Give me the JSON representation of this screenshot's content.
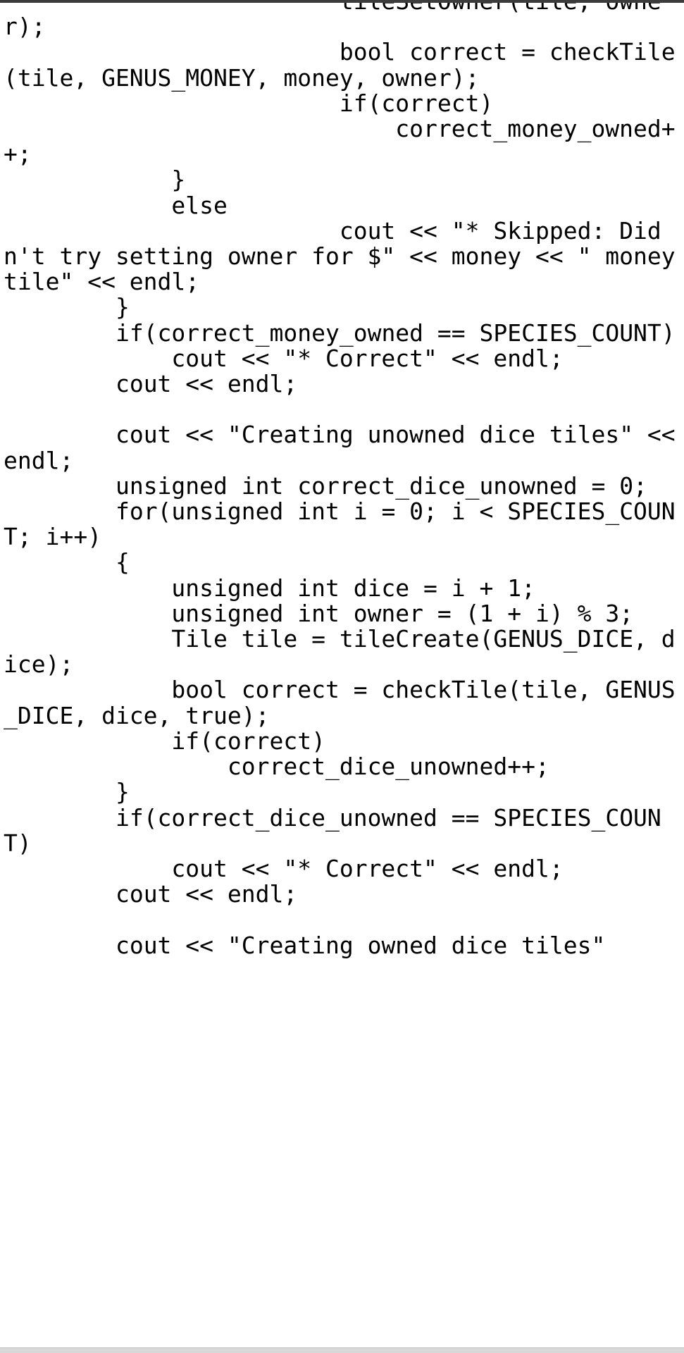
{
  "window": {
    "type": "code-text-viewer",
    "background_color": "#ffffff",
    "text_color": "#000000",
    "top_bar_color": "#3c3c3c",
    "bottom_bar_color": "#d8d8d8"
  },
  "code": {
    "language": "cpp",
    "wrap_columns": 42,
    "lines": [
      "                        tileSetOwner(tile, owner);",
      "                        bool correct = checkTile(tile, GENUS_MONEY, money, owner);",
      "                        if(correct)",
      "                            correct_money_owned++;",
      "            }",
      "            else",
      "                        cout << \"* Skipped: Didn't try setting owner for $\" << money << \" money tile\" << endl;",
      "        }",
      "        if(correct_money_owned == SPECIES_COUNT)",
      "            cout << \"* Correct\" << endl;",
      "        cout << endl;",
      "",
      "        cout << \"Creating unowned dice tiles\" << endl;",
      "        unsigned int correct_dice_unowned = 0;",
      "        for(unsigned int i = 0; i < SPECIES_COUNT; i++)",
      "        {",
      "            unsigned int dice = i + 1;",
      "            unsigned int owner = (1 + i) % 3;",
      "            Tile tile = tileCreate(GENUS_DICE, dice);",
      "            bool correct = checkTile(tile, GENUS_DICE, dice, true);",
      "            if(correct)",
      "                correct_dice_unowned++;",
      "        }",
      "        if(correct_dice_unowned == SPECIES_COUNT)",
      "            cout << \"* Correct\" << endl;",
      "        cout << endl;",
      "",
      "        cout << \"Creating owned dice tiles\""
    ],
    "full_text": "                        tileSetOwner(tile, owner);\n                        bool correct = checkTile(tile, GENUS_MONEY, money, owner);\n                        if(correct)\n                            correct_money_owned++;\n            }\n            else\n                        cout << \"* Skipped: Didn't try setting owner for $\" << money << \" money tile\" << endl;\n        }\n        if(correct_money_owned == SPECIES_COUNT)\n            cout << \"* Correct\" << endl;\n        cout << endl;\n\n        cout << \"Creating unowned dice tiles\" << endl;\n        unsigned int correct_dice_unowned = 0;\n        for(unsigned int i = 0; i < SPECIES_COUNT; i++)\n        {\n            unsigned int dice = i + 1;\n            unsigned int owner = (1 + i) % 3;\n            Tile tile = tileCreate(GENUS_DICE, dice);\n            bool correct = checkTile(tile, GENUS_DICE, dice, true);\n            if(correct)\n                correct_dice_unowned++;\n        }\n        if(correct_dice_unowned == SPECIES_COUNT)\n            cout << \"* Correct\" << endl;\n        cout << endl;\n\n        cout << \"Creating owned dice tiles\"",
    "identifiers": [
      "tileSetOwner",
      "tile",
      "owner",
      "bool",
      "correct",
      "checkTile",
      "GENUS_MONEY",
      "money",
      "if",
      "correct_money_owned",
      "else",
      "cout",
      "endl",
      "SPECIES_COUNT",
      "unsigned",
      "int",
      "correct_dice_unowned",
      "for",
      "dice",
      "Tile",
      "tileCreate",
      "GENUS_DICE",
      "true"
    ],
    "strings": [
      "* Skipped: Didn't try setting owner for $",
      " money tile",
      "* Correct",
      "Creating unowned dice tiles",
      "Creating owned dice tiles"
    ]
  }
}
